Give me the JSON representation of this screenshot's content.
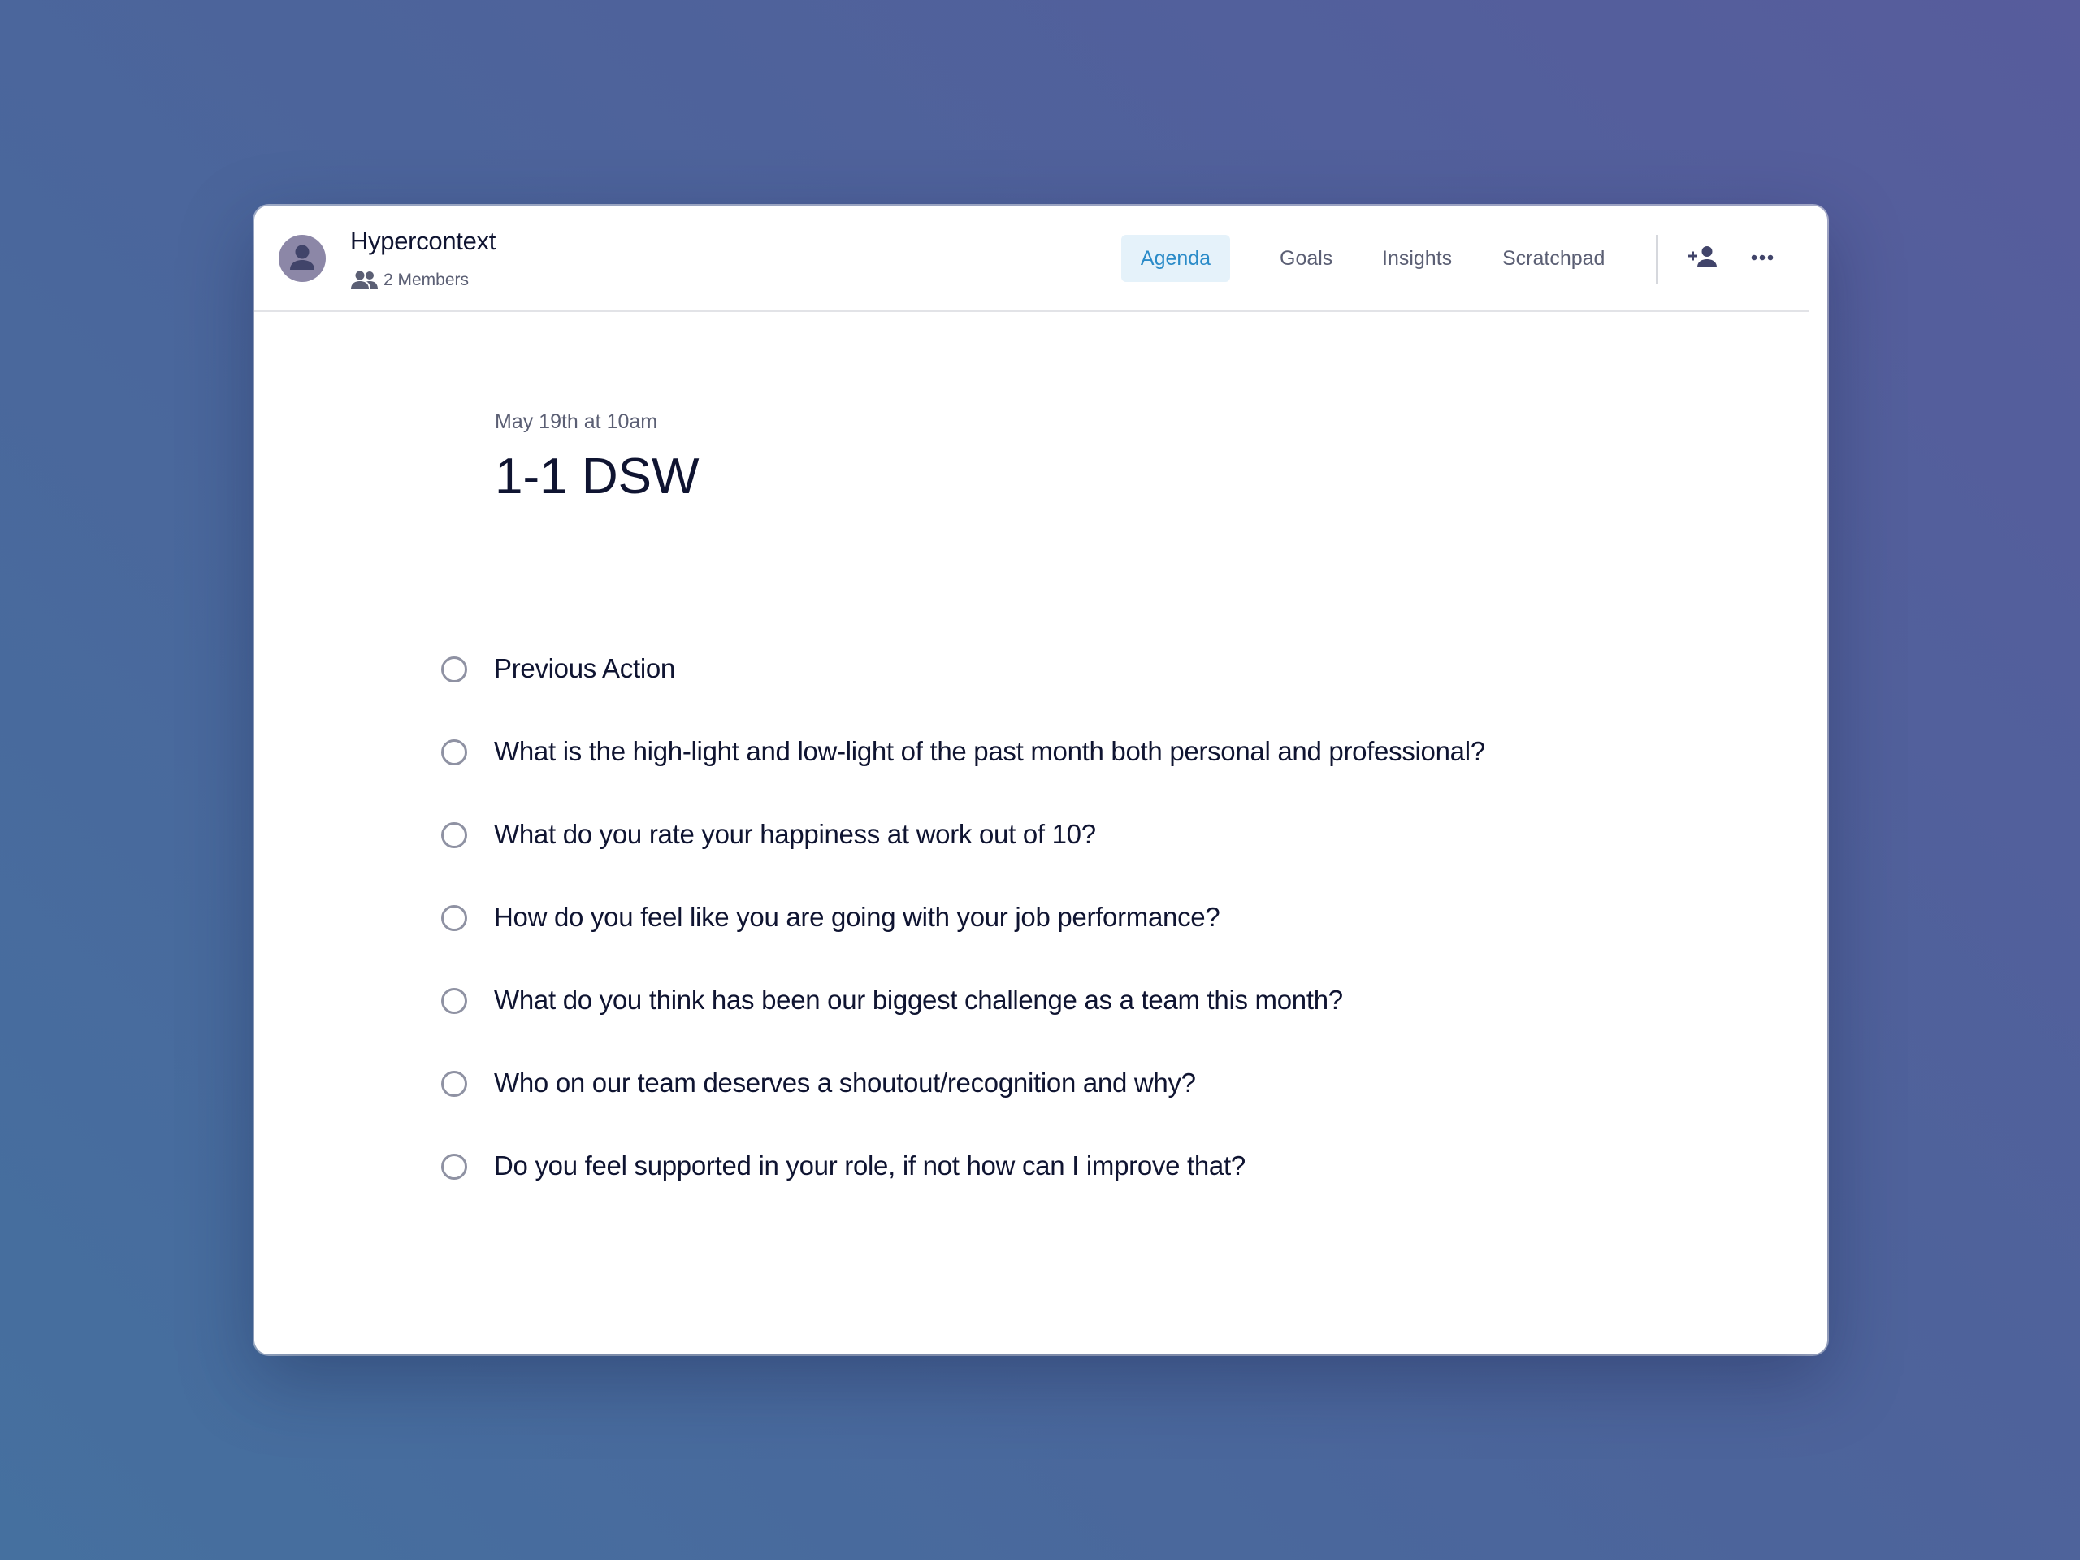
{
  "header": {
    "workspace_name": "Hypercontext",
    "members_label": "2 Members",
    "avatar_icon": "person-icon",
    "members_icon": "group-icon",
    "tabs": [
      {
        "label": "Agenda",
        "active": true
      },
      {
        "label": "Goals",
        "active": false
      },
      {
        "label": "Insights",
        "active": false
      },
      {
        "label": "Scratchpad",
        "active": false
      }
    ],
    "actions": [
      {
        "icon": "add-person-icon"
      },
      {
        "icon": "more-horizontal-icon"
      }
    ]
  },
  "meeting": {
    "date": "May 19th at 10am",
    "title": "1-1 DSW"
  },
  "agenda": {
    "items": [
      {
        "text": "Previous Action",
        "done": false
      },
      {
        "text": "What is the high-light and low-light of the past month both personal and professional?",
        "done": false
      },
      {
        "text": "What do you rate your happiness at work out of 10?",
        "done": false
      },
      {
        "text": "How do you feel like you are going with your job performance?",
        "done": false
      },
      {
        "text": "What do you think has been our biggest challenge as a team this month?",
        "done": false
      },
      {
        "text": "Who on our team deserves a shoutout/recognition and why?",
        "done": false
      },
      {
        "text": "Do you feel supported in your role, if not how can I improve that?",
        "done": false
      }
    ]
  },
  "colors": {
    "accent": "#2a8bc8",
    "accent_bg": "#e5f2fa",
    "text_primary": "#0f1431",
    "text_secondary": "#5b5f74",
    "avatar_bg": "#8c87a7"
  }
}
